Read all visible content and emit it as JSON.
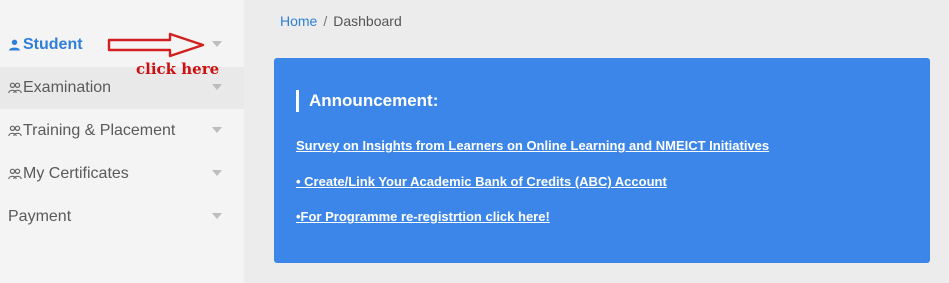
{
  "sidebar": {
    "items": [
      {
        "label": "Student",
        "icon": "user-icon"
      },
      {
        "label": "Examination",
        "icon": "users-icon"
      },
      {
        "label": "Training & Placement",
        "icon": "users-icon"
      },
      {
        "label": "My Certificates",
        "icon": "users-icon"
      },
      {
        "label": "Payment",
        "icon": ""
      }
    ]
  },
  "annotation": {
    "text": "click here",
    "color": "#cc1111"
  },
  "breadcrumb": {
    "home": "Home",
    "separator": "/",
    "current": "Dashboard"
  },
  "announcement": {
    "title": "Announcement:",
    "links": [
      "Survey on Insights from Learners on Online Learning and NMEICT Initiatives",
      "• Create/Link Your Academic Bank of Credits (ABC) Account",
      "•For Programme re-registrtion click here!"
    ]
  },
  "colors": {
    "accent": "#2f7fd8",
    "card": "#3c86ea",
    "sidebar_bg": "#f4f4f4"
  }
}
